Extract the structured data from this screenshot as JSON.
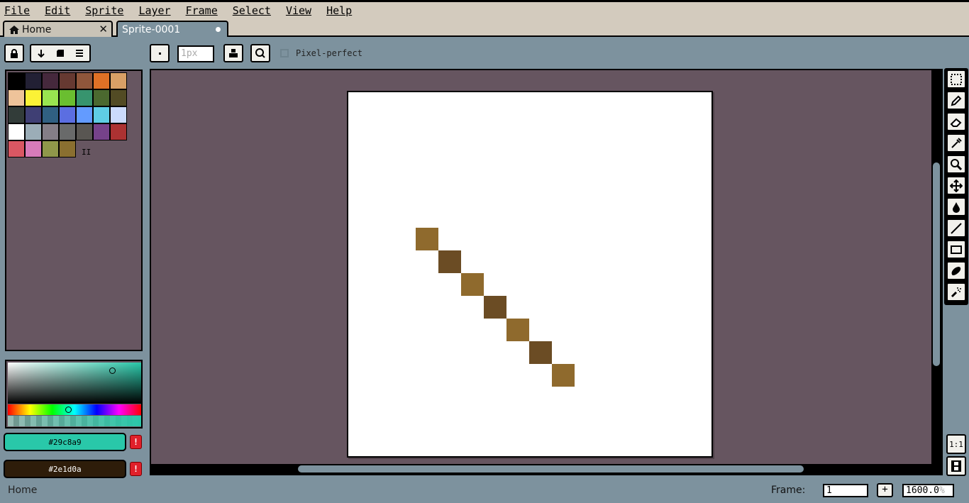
{
  "menu": [
    "File",
    "Edit",
    "Sprite",
    "Layer",
    "Frame",
    "Select",
    "View",
    "Help"
  ],
  "tabs": {
    "home": {
      "label": "Home",
      "icon": "home-icon",
      "close": "✕"
    },
    "sprite": {
      "label": "Sprite-0001",
      "modified_indicator": "dot"
    }
  },
  "toolbar": {
    "brush_size_placeholder": "1px",
    "pixel_perfect_label": "Pixel-perfect",
    "pixel_perfect_checked": false
  },
  "palette": {
    "colors": [
      "#000000",
      "#222034",
      "#45283c",
      "#663931",
      "#8f563b",
      "#df7126",
      "#d9a066",
      "#eec39a",
      "#fbf236",
      "#99e550",
      "#6abe30",
      "#37946e",
      "#4b692f",
      "#524b24",
      "#323c39",
      "#3f3f74",
      "#306082",
      "#5b6ee1",
      "#639bff",
      "#5fcde4",
      "#cbdbfc",
      "#ffffff",
      "#9badb7",
      "#847e87",
      "#696a6a",
      "#595652",
      "#76428a",
      "#ac3232",
      "#d95763",
      "#d77bba",
      "#8f974a",
      "#8a6f30"
    ],
    "handle": "II"
  },
  "colors": {
    "foreground": "#29c8a9",
    "background": "#2e1d0a",
    "fg_label": "#29c8a9",
    "bg_label": "#2e1d0a",
    "warning": "!"
  },
  "canvas": {
    "pixels": [
      {
        "col": 9,
        "row": 12,
        "color": "#8f6a2d"
      },
      {
        "col": 8,
        "row": 11,
        "color": "#6b4c24"
      },
      {
        "col": 7,
        "row": 10,
        "color": "#8f6a2d"
      },
      {
        "col": 6,
        "row": 9,
        "color": "#6b4c24"
      },
      {
        "col": 5,
        "row": 8,
        "color": "#8f6a2d"
      },
      {
        "col": 4,
        "row": 7,
        "color": "#6b4c24"
      },
      {
        "col": 3,
        "row": 6,
        "color": "#8f6a2d"
      }
    ]
  },
  "tools": [
    "marquee-icon",
    "pencil-icon",
    "eraser-icon",
    "eyedropper-icon",
    "zoom-icon",
    "move-icon",
    "fill-icon",
    "line-icon",
    "rectangle-icon",
    "ellipse-icon",
    "spray-icon"
  ],
  "bottom_tools": {
    "one_to_one": "1:1",
    "timeline": "filmstrip-icon"
  },
  "status": {
    "left": "Home",
    "frame_label": "Frame:",
    "frame_value": "1",
    "add": "+",
    "zoom_value": "1600.0",
    "zoom_unit": "%"
  }
}
